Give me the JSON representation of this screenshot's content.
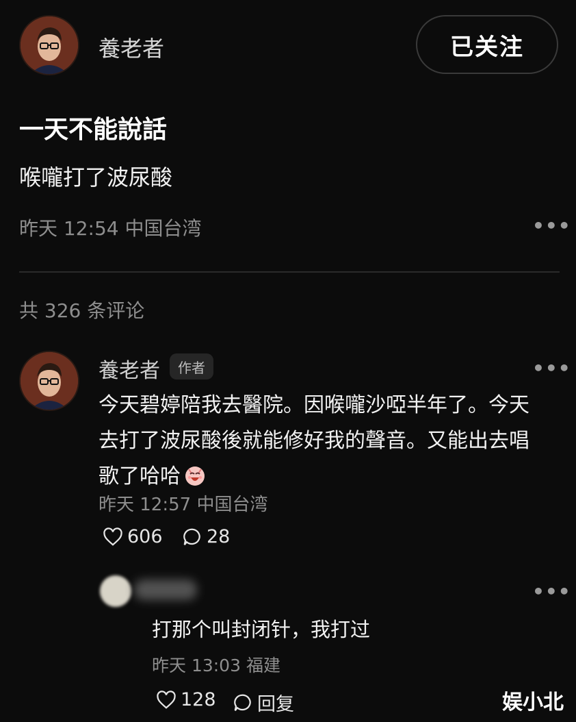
{
  "post": {
    "author": {
      "name": "養老者"
    },
    "follow_button": "已关注",
    "title": "一天不能說話",
    "body": "喉嚨打了波尿酸",
    "meta": "昨天 12:54 中国台湾",
    "more_icon": "more-horizontal-icon"
  },
  "comments_header": {
    "count_text": "共 326 条评论"
  },
  "comment": {
    "author": "養老者",
    "badge": "作者",
    "lines": [
      "今天碧婷陪我去醫院。因喉嚨沙啞半年了。今天",
      "去打了波尿酸後就能修好我的聲音。又能出去唱",
      "歌了哈哈"
    ],
    "emoji": "laughing-emoji",
    "meta": "昨天 12:57 中国台湾",
    "likes": "606",
    "replies": "28"
  },
  "reply": {
    "text": "打那个叫封闭针，我打过",
    "meta": "昨天 13:03 福建",
    "likes": "128",
    "reply_label": "回复"
  },
  "watermark": "娱小北",
  "colors": {
    "background": "#0c0c0c",
    "muted": "#8e8e8e",
    "divider": "#2b2b2b",
    "button_border": "#3a3a3a"
  }
}
